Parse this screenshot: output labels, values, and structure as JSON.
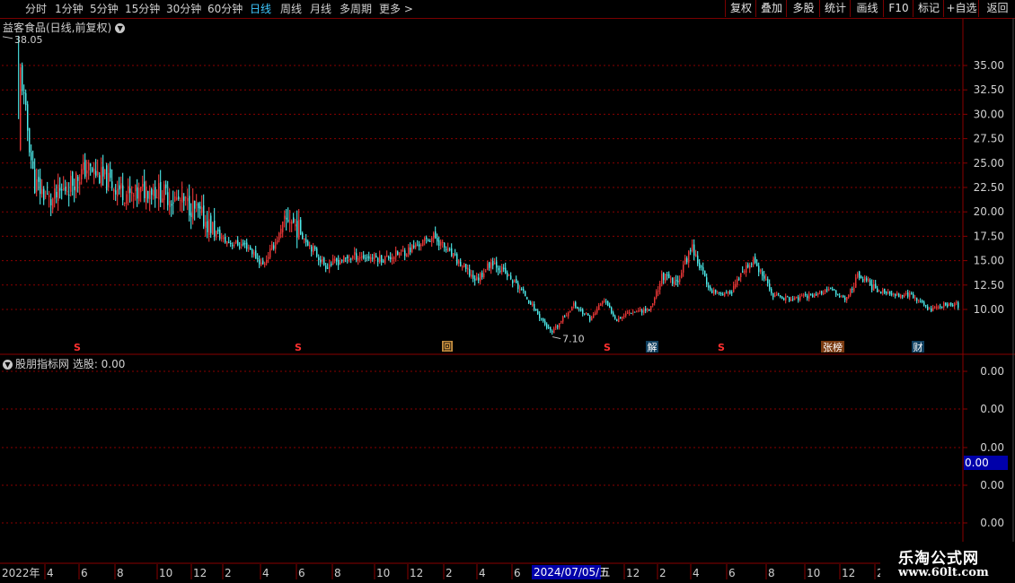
{
  "toolbar": {
    "periods": [
      "分时",
      "1分钟",
      "5分钟",
      "15分钟",
      "30分钟",
      "60分钟",
      "日线",
      "周线",
      "月线",
      "多周期",
      "更多"
    ],
    "active_period": "日线",
    "right_buttons": [
      "复权",
      "叠加",
      "多股",
      "统计",
      "画线",
      "F10",
      "标记",
      "+自选",
      "返回"
    ]
  },
  "main_title": "益客食品(日线,前复权)",
  "indicator_title": "股朋指标网  选股: 0.00",
  "markers": [
    "S",
    "S",
    "回",
    "S",
    "解",
    "S",
    "张榜",
    "财"
  ],
  "colors": {
    "up": "#ff3c3c",
    "down": "#54ffff",
    "grid": "#8a0000",
    "axis_text": "#d0d0d0",
    "date_highlight": "#0000aa"
  },
  "logo": {
    "line1": "乐淘公式网",
    "line2": "www.60lt.com"
  },
  "chart_data": [
    {
      "type": "line",
      "name": "price",
      "ylim": [
        7.1,
        38.05
      ],
      "yticks": [
        "35.00",
        "32.50",
        "30.00",
        "27.50",
        "25.00",
        "22.50",
        "20.00",
        "17.50",
        "15.00",
        "12.50",
        "10.00"
      ],
      "annotations": [
        {
          "label": "38.05"
        },
        {
          "label": "7.10"
        }
      ],
      "x": [
        "2022-02-24",
        "2022-03-20",
        "2022-04-15",
        "2022-06-10",
        "2022-08-20",
        "2022-09-15",
        "2022-11-20",
        "2023-01-10",
        "2023-02-15",
        "2023-03-10",
        "2023-04-20",
        "2023-06-15",
        "2023-08-01",
        "2023-09-15",
        "2023-10-20",
        "2023-12-01",
        "2024-01-20",
        "2024-02-05",
        "2024-03-01",
        "2024-04-15",
        "2024-06-01",
        "2024-07-05",
        "2024-08-01",
        "2024-08-20",
        "2024-09-10",
        "2024-10-01",
        "2024-11-01",
        "2024-11-20",
        "2024-12-10",
        "2025-01-05",
        "2025-02-01",
        "2025-03-01",
        "2025-04-10",
        "2025-05-10",
        "2025-06-10",
        "2025-07-10",
        "2025-08-10",
        "2025-09-01",
        "2025-09-20",
        "2025-10-20",
        "2025-11-10",
        "2025-12-10",
        "2026-01-10",
        "2026-02-01",
        "2026-02-20",
        "2026-03-10"
      ],
      "y": [
        36.0,
        23.0,
        21.0,
        24.5,
        21.5,
        22.5,
        20.5,
        17.0,
        16.5,
        14.5,
        19.5,
        14.5,
        15.5,
        15.2,
        16.0,
        17.5,
        14.0,
        13.0,
        15.0,
        12.0,
        7.5,
        10.5,
        9.0,
        11.0,
        9.0,
        9.8,
        10.0,
        13.5,
        12.5,
        16.5,
        12.0,
        11.5,
        15.0,
        11.5,
        11.0,
        11.5,
        12.0,
        11.0,
        13.5,
        12.0,
        11.5,
        11.5,
        10.0,
        10.5,
        10.5,
        9.0
      ]
    },
    {
      "type": "line",
      "name": "选股",
      "yticks": [
        "0.00",
        "0.00",
        "0.00",
        "0.00",
        "0.00"
      ],
      "current_value": "0.00",
      "values": [
        0.0,
        0.0
      ]
    }
  ],
  "x_axis": {
    "first_label": "2022年",
    "ticks": [
      "4",
      "6",
      "8",
      "10",
      "12",
      "2",
      "4",
      "6",
      "8",
      "10",
      "12",
      "2",
      "4",
      "6",
      "8",
      "10",
      "12",
      "2",
      "4",
      "6",
      "8",
      "10",
      "12",
      "2"
    ],
    "highlight_label": "2024/07/05/五"
  }
}
